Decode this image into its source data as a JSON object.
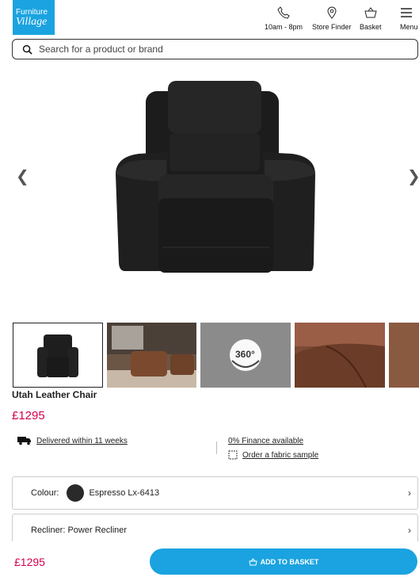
{
  "brand": {
    "line1": "Furniture",
    "line2": "Village"
  },
  "header": {
    "hours_label": "10am - 8pm",
    "store_finder_label": "Store Finder",
    "basket_label": "Basket",
    "menu_label": "Menu"
  },
  "search": {
    "placeholder": "Search for a product or brand"
  },
  "gallery": {
    "prev": "❮",
    "next": "❯",
    "badge_360": "360°"
  },
  "product": {
    "title": "Utah Leather Chair",
    "price": "£1295"
  },
  "info": {
    "delivery": "Delivered within 11 weeks",
    "finance": "0% Finance available",
    "fabric_sample": "Order a fabric sample"
  },
  "options": {
    "colour_label": "Colour:",
    "colour_value": "Espresso Lx-6413",
    "recliner_label": "Recliner: Power Recliner",
    "chevron": "›"
  },
  "footer": {
    "price": "£1295",
    "add_to_basket": "ADD TO BASKET"
  },
  "colors": {
    "brand_blue": "#1aa3e0",
    "price_pink": "#d6004e",
    "swatch": "#2a2a2a"
  }
}
